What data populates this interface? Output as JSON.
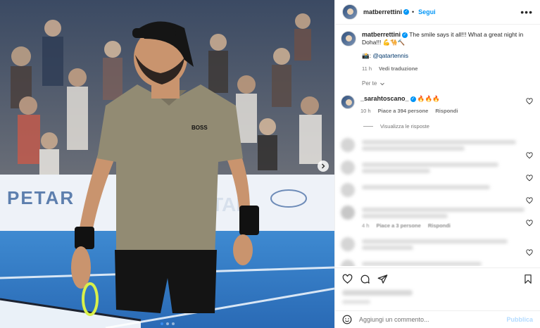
{
  "post": {
    "username": "matberrettini",
    "follow_label": "Segui",
    "separator": "•",
    "more_label": "•••",
    "caption_text": "The smile says it all!!! What a great night in Doha!!! 💪🐪🔨",
    "tag_prefix": "📸:",
    "tag_handle": "@qatartennis",
    "time_ago": "11 h",
    "translate_label": "Vedi traduzione",
    "sort_label": "Per te",
    "photo_banner_text": "PETAR",
    "photo_shirt_logo": "BOSS"
  },
  "comments": [
    {
      "username": "_sarahtoscano_",
      "text": "🔥🔥🔥",
      "time": "10 h",
      "likes": "Piace a 394 persone",
      "reply_label": "Rispondi",
      "replies_toggle": "Visualizza le risposte"
    }
  ],
  "blurred_comment_meta": {
    "time": "4 h",
    "likes": "Piace a 3 persone",
    "reply_label": "Rispondi"
  },
  "composer": {
    "placeholder": "Aggiungi un commento...",
    "publish_label": "Pubblica"
  },
  "colors": {
    "accent": "#0095f6",
    "publish_disabled": "#b3dbff",
    "muted_text": "#737373"
  },
  "icons": [
    "like-icon",
    "comment-icon",
    "share-icon",
    "bookmark-icon",
    "emoji-icon",
    "chevron-down-icon",
    "chevron-right-icon",
    "verified-icon"
  ]
}
